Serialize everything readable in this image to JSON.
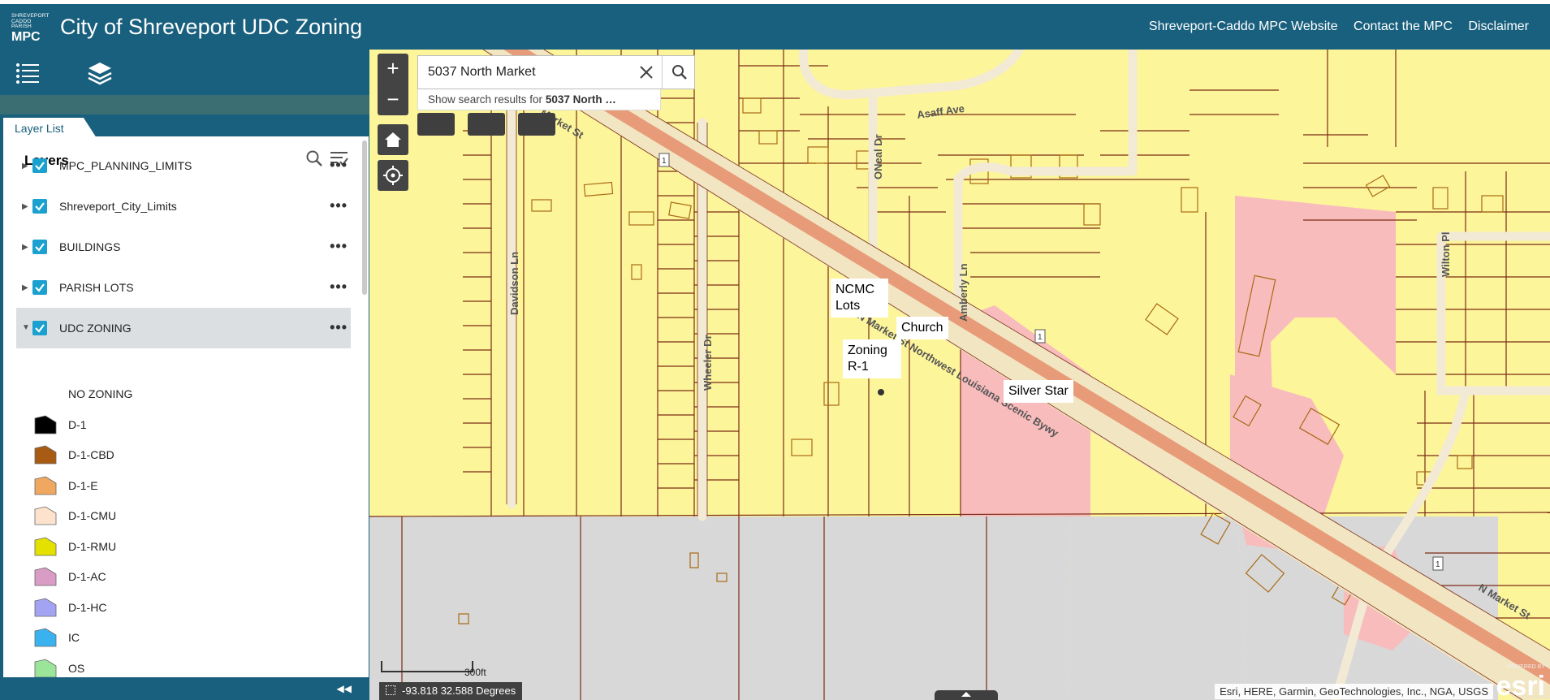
{
  "header": {
    "logo_line1": "SHREVEPORT",
    "logo_line2": "CADDO PARISH",
    "logo_line3": "MPC",
    "title": "City of Shreveport UDC Zoning",
    "links": [
      "Shreveport-Caddo MPC Website",
      "Contact the MPC",
      "Disclaimer"
    ]
  },
  "toolbar": {
    "icons": [
      "layer-list-icon",
      "layers-icon"
    ]
  },
  "panel": {
    "tab_label": "Layer List",
    "title": "Layers",
    "layers": [
      {
        "label": "MPC_PLANNING_LIMITS",
        "checked": true,
        "expanded": false
      },
      {
        "label": "Shreveport_City_Limits",
        "checked": true,
        "expanded": false
      },
      {
        "label": "BUILDINGS",
        "checked": true,
        "expanded": false
      },
      {
        "label": "PARISH LOTS",
        "checked": true,
        "expanded": false
      },
      {
        "label": "UDC ZONING",
        "checked": true,
        "expanded": true
      }
    ],
    "more_label": "•••",
    "legend": [
      {
        "label": "NO ZONING",
        "color": ""
      },
      {
        "label": "D-1",
        "color": "#000000"
      },
      {
        "label": "D-1-CBD",
        "color": "#a85b12"
      },
      {
        "label": "D-1-E",
        "color": "#f0a860"
      },
      {
        "label": "D-1-CMU",
        "color": "#fde3cd"
      },
      {
        "label": "D-1-RMU",
        "color": "#e4e000"
      },
      {
        "label": "D-1-AC",
        "color": "#d99cc4"
      },
      {
        "label": "D-1-HC",
        "color": "#a3a3f3"
      },
      {
        "label": "IC",
        "color": "#3bb2f0"
      },
      {
        "label": "OS",
        "color": "#9be59b"
      }
    ]
  },
  "search": {
    "value": "5037 North Market",
    "suggestion_prefix": "Show search results for",
    "suggestion_bold": "5037 North …"
  },
  "map": {
    "zoom_in": "+",
    "zoom_out": "−",
    "labels": {
      "ncmc": "NCMC Lots",
      "church": "Church",
      "zoning": "Zoning R-1",
      "silver_star": "Silver Star"
    },
    "streets": {
      "market_st": "Market St",
      "n_market_scenic": "N Market St Northwest Louisiana Scenic Bywy",
      "n_market_st": "N Market St",
      "davidson": "Davidson Ln",
      "wheeler": "Wheeler Dr",
      "oneal": "ONeal Dr",
      "amberly": "Amberly Ln",
      "asaff": "Asaff Ave",
      "wilton": "Wilton Pl",
      "route": "1"
    },
    "scale_label": "300ft",
    "coordinates": "-93.818 32.588 Degrees",
    "attribution": "Esri, HERE, Garmin, GeoTechnologies, Inc., NGA, USGS",
    "esri_powered": "POWERED BY",
    "esri_name": "esri"
  },
  "colors": {
    "header": "#19607e",
    "residential": "#fdf59a",
    "commercial_pink": "#f9bcbd",
    "unzoned_gray": "#d8d8d8",
    "road": "#f4e7c7",
    "arterial": "#e89b78",
    "parcel_line": "#7b2c14"
  }
}
